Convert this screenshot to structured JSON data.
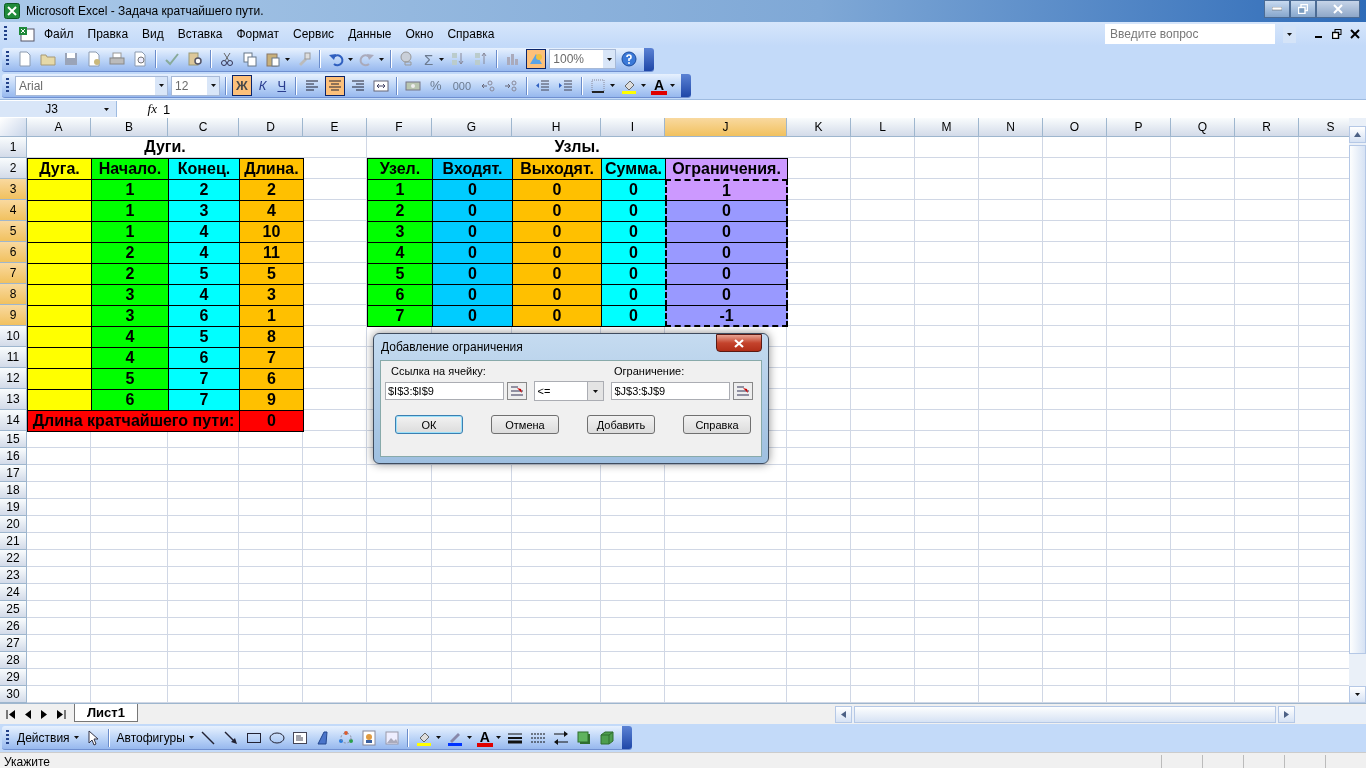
{
  "window": {
    "title": "Microsoft Excel - Задача кратчайшего пути."
  },
  "menu": [
    "Файл",
    "Правка",
    "Вид",
    "Вставка",
    "Формат",
    "Сервис",
    "Данные",
    "Окно",
    "Справка"
  ],
  "help_search": {
    "placeholder": "Введите вопрос"
  },
  "standard_toolbar": {
    "sum": "Σ",
    "zoom": "100%",
    "drawing_selected": true
  },
  "format_toolbar": {
    "font": "Arial",
    "size": "12",
    "styles": [
      {
        "label": "Ж",
        "kind": "bold",
        "selected": true
      },
      {
        "label": "К",
        "kind": "italic",
        "selected": false
      },
      {
        "label": "Ч",
        "kind": "underline",
        "selected": false
      }
    ],
    "alignment": [
      {
        "kind": "left",
        "selected": false
      },
      {
        "kind": "center",
        "selected": true
      },
      {
        "kind": "right",
        "selected": false
      }
    ],
    "percent": "%",
    "thousands": "000",
    "font_color": "A"
  },
  "formula_bar": {
    "name_box": "J3",
    "function_label": "fx",
    "formula": "1"
  },
  "sheet": {
    "columns": [
      {
        "label": "A",
        "selected": false
      },
      {
        "label": "B",
        "selected": false
      },
      {
        "label": "C",
        "selected": false
      },
      {
        "label": "D",
        "selected": false
      },
      {
        "label": "E",
        "selected": false
      },
      {
        "label": "F",
        "selected": false
      },
      {
        "label": "G",
        "selected": false
      },
      {
        "label": "H",
        "selected": false
      },
      {
        "label": "I",
        "selected": false
      },
      {
        "label": "J",
        "selected": true
      },
      {
        "label": "K",
        "selected": false
      },
      {
        "label": "L",
        "selected": false
      },
      {
        "label": "M",
        "selected": false
      },
      {
        "label": "N",
        "selected": false
      },
      {
        "label": "O",
        "selected": false
      },
      {
        "label": "P",
        "selected": false
      },
      {
        "label": "Q",
        "selected": false
      },
      {
        "label": "R",
        "selected": false
      },
      {
        "label": "S",
        "selected": false
      }
    ],
    "rows": [
      {
        "label": "1",
        "selected": false
      },
      {
        "label": "2",
        "selected": false
      },
      {
        "label": "3",
        "selected": true
      },
      {
        "label": "4",
        "selected": true
      },
      {
        "label": "5",
        "selected": true
      },
      {
        "label": "6",
        "selected": true
      },
      {
        "label": "7",
        "selected": true
      },
      {
        "label": "8",
        "selected": true
      },
      {
        "label": "9",
        "selected": true
      },
      {
        "label": "10",
        "selected": false
      },
      {
        "label": "11",
        "selected": false
      },
      {
        "label": "12",
        "selected": false
      },
      {
        "label": "13",
        "selected": false
      },
      {
        "label": "14",
        "selected": false
      },
      {
        "label": "15",
        "selected": false
      },
      {
        "label": "16",
        "selected": false
      },
      {
        "label": "17",
        "selected": false
      },
      {
        "label": "18",
        "selected": false
      },
      {
        "label": "19",
        "selected": false
      },
      {
        "label": "20",
        "selected": false
      },
      {
        "label": "21",
        "selected": false
      },
      {
        "label": "22",
        "selected": false
      },
      {
        "label": "23",
        "selected": false
      },
      {
        "label": "24",
        "selected": false
      },
      {
        "label": "25",
        "selected": false
      },
      {
        "label": "26",
        "selected": false
      },
      {
        "label": "27",
        "selected": false
      },
      {
        "label": "28",
        "selected": false
      },
      {
        "label": "29",
        "selected": false
      },
      {
        "label": "30",
        "selected": false
      }
    ]
  },
  "arcs": {
    "title": "Дуги.",
    "columns": [
      {
        "header": "Дуга.",
        "kind": "arc",
        "color": "#ffff00"
      },
      {
        "header": "Начало.",
        "kind": "start",
        "color": "#00ff00"
      },
      {
        "header": "Конец.",
        "kind": "end",
        "color": "#00ffff"
      },
      {
        "header": "Длина.",
        "kind": "length",
        "color": "#ffc000"
      }
    ],
    "rows": [
      {
        "start": "1",
        "end": "2",
        "length": "2"
      },
      {
        "start": "1",
        "end": "3",
        "length": "4"
      },
      {
        "start": "1",
        "end": "4",
        "length": "10"
      },
      {
        "start": "2",
        "end": "4",
        "length": "11"
      },
      {
        "start": "2",
        "end": "5",
        "length": "5"
      },
      {
        "start": "3",
        "end": "4",
        "length": "3"
      },
      {
        "start": "3",
        "end": "6",
        "length": "1"
      },
      {
        "start": "4",
        "end": "5",
        "length": "8"
      },
      {
        "start": "4",
        "end": "6",
        "length": "7"
      },
      {
        "start": "5",
        "end": "7",
        "length": "6"
      },
      {
        "start": "6",
        "end": "7",
        "length": "9"
      }
    ],
    "total": {
      "label": "Длина кратчайшего пути:",
      "value": "0",
      "color": "#ff0000"
    }
  },
  "nodes": {
    "title": "Узлы.",
    "columns": [
      {
        "header": "Узел.",
        "kind": "node",
        "color": "#00ff00"
      },
      {
        "header": "Входят.",
        "kind": "in",
        "color": "#00ccff"
      },
      {
        "header": "Выходят.",
        "kind": "out",
        "color": "#ffc000"
      },
      {
        "header": "Сумма.",
        "kind": "sum",
        "color": "#00ffff"
      },
      {
        "header": "Ограничения.",
        "kind": "limit",
        "color": "#cc99ff"
      }
    ],
    "rows": [
      {
        "node": "1",
        "in": "0",
        "out": "0",
        "sum": "0",
        "limit": "1",
        "selected": false
      },
      {
        "node": "2",
        "in": "0",
        "out": "0",
        "sum": "0",
        "limit": "0",
        "selected": true
      },
      {
        "node": "3",
        "in": "0",
        "out": "0",
        "sum": "0",
        "limit": "0",
        "selected": true
      },
      {
        "node": "4",
        "in": "0",
        "out": "0",
        "sum": "0",
        "limit": "0",
        "selected": true
      },
      {
        "node": "5",
        "in": "0",
        "out": "0",
        "sum": "0",
        "limit": "0",
        "selected": true
      },
      {
        "node": "6",
        "in": "0",
        "out": "0",
        "sum": "0",
        "limit": "0",
        "selected": true
      },
      {
        "node": "7",
        "in": "0",
        "out": "0",
        "sum": "0",
        "limit": "-1",
        "selected": true
      }
    ]
  },
  "dialog": {
    "title": "Добавление ограничения",
    "cell_ref": {
      "label": "Ссылка на ячейку:",
      "value": "$I$3:$I$9"
    },
    "operator": "<=",
    "constraint": {
      "label": "Ограничение:",
      "value": "$J$3:$J$9"
    },
    "buttons": [
      {
        "label": "ОК",
        "default": true
      },
      {
        "label": "Отмена",
        "default": false
      },
      {
        "label": "Добавить",
        "default": false
      },
      {
        "label": "Справка",
        "default": false
      }
    ]
  },
  "sheet_tabs": [
    {
      "label": "Лист1",
      "selected": true
    }
  ],
  "drawing_toolbar": {
    "actions": "Действия",
    "autoshapes": "Автофигуры",
    "font_color": "A"
  },
  "status_bar": "Укажите"
}
